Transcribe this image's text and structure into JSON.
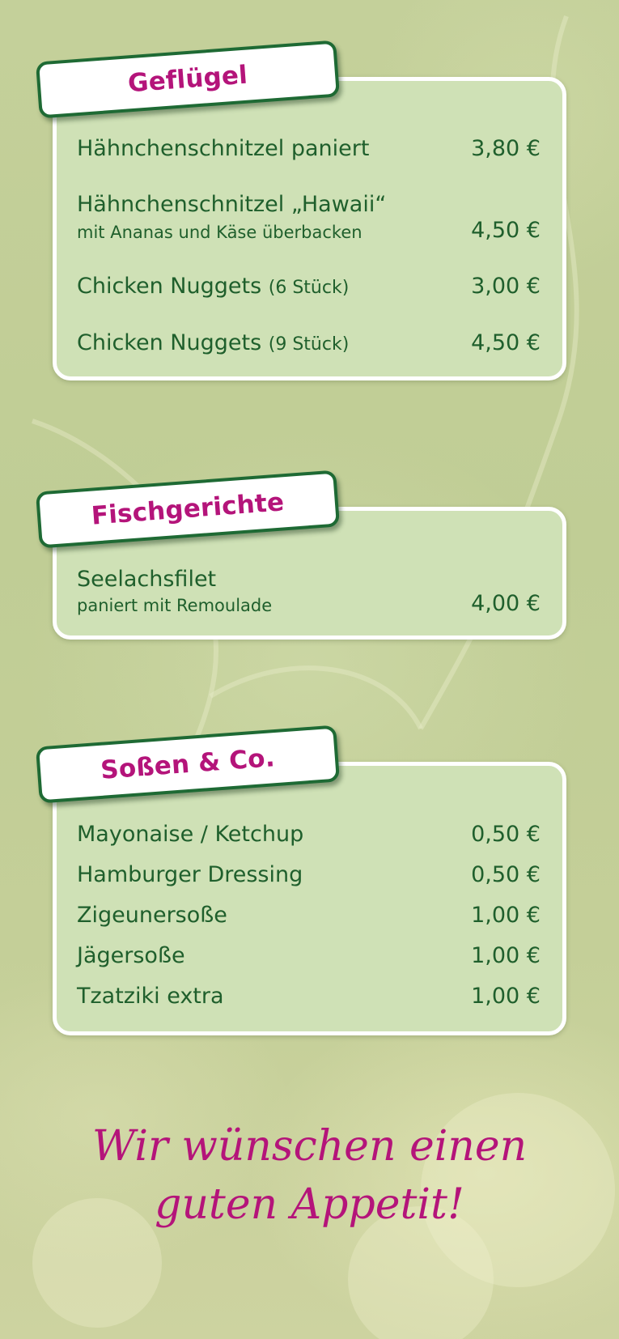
{
  "sections": [
    {
      "title": "Geflügel",
      "items": [
        {
          "name": "Hähnchenschnitzel paniert",
          "price": "3,80 €"
        },
        {
          "name": "Hähnchenschnitzel „Hawaii“",
          "description": "mit Ananas und Käse überbacken",
          "price": "4,50 €"
        },
        {
          "name": "Chicken Nuggets",
          "note": "(6 Stück)",
          "price": "3,00 €"
        },
        {
          "name": "Chicken Nuggets",
          "note": "(9 Stück)",
          "price": "4,50 €"
        }
      ]
    },
    {
      "title": "Fischgerichte",
      "items": [
        {
          "name": "Seelachsfilet",
          "description": "paniert mit Remoulade",
          "price": "4,00 €"
        }
      ]
    },
    {
      "title": "Soßen & Co.",
      "items": [
        {
          "name": "Mayonaise / Ketchup",
          "price": "0,50 €"
        },
        {
          "name": "Hamburger Dressing",
          "price": "0,50 €"
        },
        {
          "name": "Zigeunersoße",
          "price": "1,00 €"
        },
        {
          "name": "Jägersoße",
          "price": "1,00 €"
        },
        {
          "name": "Tzatziki extra",
          "price": "1,00 €"
        }
      ]
    }
  ],
  "closing": {
    "line1": "Wir wünschen einen",
    "line2": "guten Appetit!"
  },
  "colors": {
    "accent": "#b4147a",
    "text": "#1f5f2c",
    "panel": "#cfe1b6",
    "tab_border": "#1e6a34"
  }
}
